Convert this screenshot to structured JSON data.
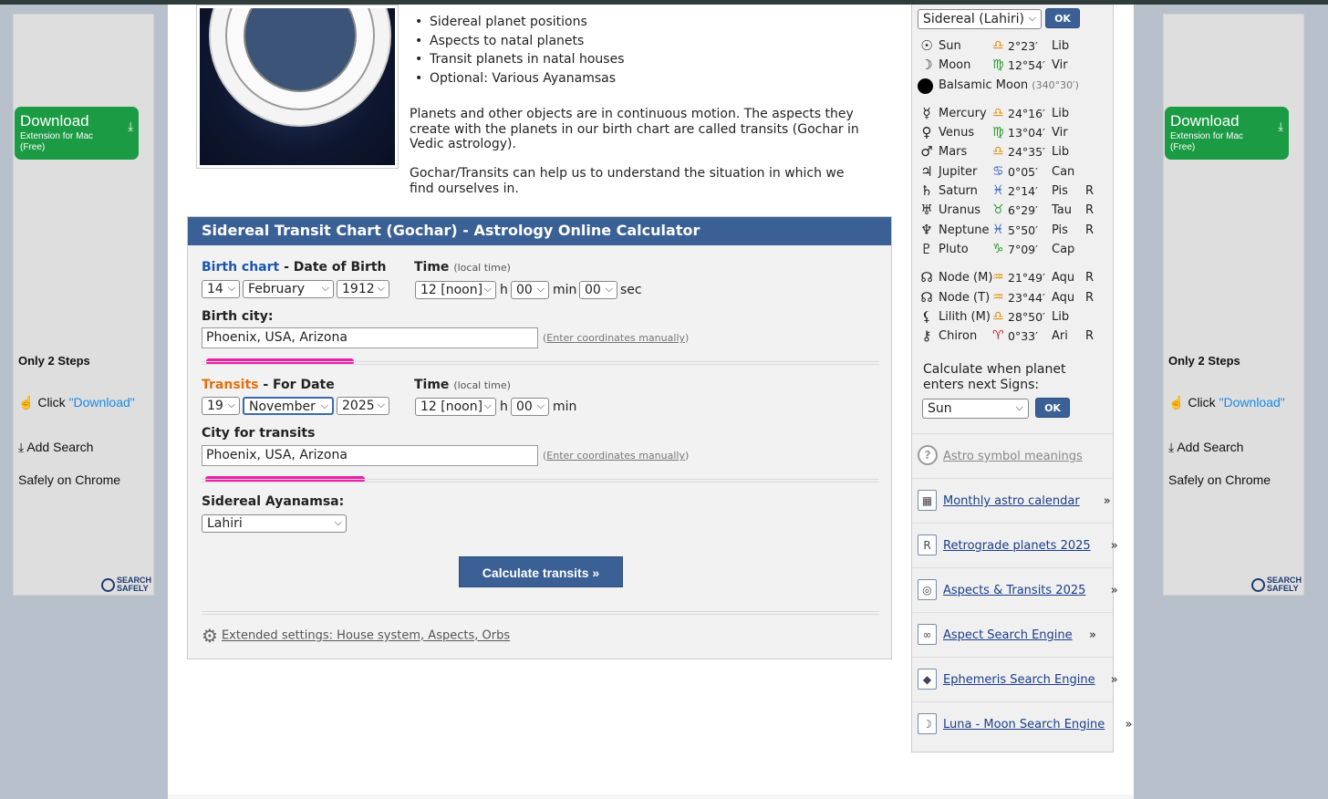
{
  "ad": {
    "download_title": "Download",
    "download_sub": "Extension for Mac (Free)",
    "steps_title": "Only 2 Steps",
    "step1_prefix": "Click ",
    "step1_link": "\"Download\"",
    "step2": "Add Search",
    "step3": "Safely on Chrome",
    "brand_line1": "SEARCH",
    "brand_line2": "SAFELY",
    "colors": {
      "button": "#1b9b43",
      "link": "#1a88e6"
    }
  },
  "intro": {
    "bullets": [
      "Sidereal planet positions",
      "Aspects to natal planets",
      "Transit planets in natal houses",
      "Optional: Various Ayanamsas"
    ],
    "para1": "Planets and other objects are in continuous motion. The aspects they create with the planets in our birth chart are called transits (Gochar in Vedic astrology).",
    "para2": "Gochar/Transits can help us to understand the situation in which we find ourselves in."
  },
  "calc": {
    "title": "Sidereal Transit Chart (Gochar) - Astrology Online Calculator",
    "birth_label_link": "Birth chart",
    "birth_label_rest": " - Date of Birth",
    "time_label": "Time",
    "time_small": "(local time)",
    "birth_day": "14",
    "birth_month": "February",
    "birth_year": "1912",
    "birth_hour": "12 [noon]",
    "birth_min": "00",
    "birth_sec": "00",
    "unit_h": "h",
    "unit_min": "min",
    "unit_sec": "sec",
    "birth_city_label": "Birth city:",
    "birth_city": "Phoenix, USA, Arizona",
    "coords_link": "Enter coordinates manually",
    "transit_label_link": "Transits",
    "transit_label_rest": " - For Date",
    "transit_day": "19",
    "transit_month": "November",
    "transit_year": "2025",
    "transit_hour": "12 [noon]",
    "transit_min": "00",
    "transit_city_label": "City for transits",
    "transit_city": "Phoenix, USA, Arizona",
    "ayanamsa_label": "Sidereal Ayanamsa:",
    "ayanamsa": "Lahiri",
    "calculate_button": "Calculate transits »",
    "extended": "Extended settings: House system, Aspects, Orbs",
    "colors": {
      "header": "#3a6095",
      "birth": "#1a55b0",
      "transit": "#e07010",
      "highlight": "#ee1fa6"
    }
  },
  "sidebar": {
    "ayanamsa_select": "Sidereal (Lahiri)",
    "ok": "OK",
    "planets": [
      {
        "glyph": "☉",
        "name": "Sun",
        "sign_glyph": "♎",
        "deg": "2°23′",
        "sign": "Lib",
        "r": "",
        "el": "air"
      },
      {
        "glyph": "☽",
        "name": "Moon",
        "sign_glyph": "♍",
        "deg": "12°54′",
        "sign": "Vir",
        "r": "",
        "el": "earth"
      }
    ],
    "balsamic": "Balsamic Moon",
    "balsamic_deg": "(340°30′)",
    "planets2": [
      {
        "glyph": "☿",
        "name": "Mercury",
        "sign_glyph": "♎",
        "deg": "24°16′",
        "sign": "Lib",
        "r": "",
        "el": "air"
      },
      {
        "glyph": "♀",
        "name": "Venus",
        "sign_glyph": "♍",
        "deg": "13°04′",
        "sign": "Vir",
        "r": "",
        "el": "earth"
      },
      {
        "glyph": "♂",
        "name": "Mars",
        "sign_glyph": "♎",
        "deg": "24°35′",
        "sign": "Lib",
        "r": "",
        "el": "air"
      },
      {
        "glyph": "♃",
        "name": "Jupiter",
        "sign_glyph": "♋",
        "deg": "0°05′",
        "sign": "Can",
        "r": "",
        "el": "water"
      },
      {
        "glyph": "♄",
        "name": "Saturn",
        "sign_glyph": "♓",
        "deg": "2°14′",
        "sign": "Pis",
        "r": "R",
        "el": "water"
      },
      {
        "glyph": "♅",
        "name": "Uranus",
        "sign_glyph": "♉",
        "deg": "6°29′",
        "sign": "Tau",
        "r": "R",
        "el": "earth"
      },
      {
        "glyph": "♆",
        "name": "Neptune",
        "sign_glyph": "♓",
        "deg": "5°50′",
        "sign": "Pis",
        "r": "R",
        "el": "water"
      },
      {
        "glyph": "♇",
        "name": "Pluto",
        "sign_glyph": "♑",
        "deg": "7°09′",
        "sign": "Cap",
        "r": "",
        "el": "earth"
      }
    ],
    "planets3": [
      {
        "glyph": "☊",
        "name": "Node (M)",
        "sign_glyph": "♒",
        "deg": "21°49′",
        "sign": "Aqu",
        "r": "R",
        "el": "air"
      },
      {
        "glyph": "☊",
        "name": "Node (T)",
        "sign_glyph": "♒",
        "deg": "23°44′",
        "sign": "Aqu",
        "r": "R",
        "el": "air"
      },
      {
        "glyph": "⚸",
        "name": "Lilith (M)",
        "sign_glyph": "♎",
        "deg": "28°50′",
        "sign": "Lib",
        "r": "",
        "el": "air"
      },
      {
        "glyph": "⚷",
        "name": "Chiron",
        "sign_glyph": "♈",
        "deg": "0°33′",
        "sign": "Ari",
        "r": "R",
        "el": "fire"
      }
    ],
    "enter_text": "Calculate when planet enters next Signs:",
    "enter_select": "Sun",
    "links": [
      {
        "icon": "question-icon",
        "text": "Astro symbol meanings",
        "grey": true
      },
      {
        "icon": "calendar-icon",
        "text": "Monthly astro calendar",
        "grey": false
      },
      {
        "icon": "retrograde-icon",
        "text": "Retrograde planets 2025",
        "grey": false
      },
      {
        "icon": "globe-icon",
        "text": "Aspects & Transits 2025",
        "grey": false
      },
      {
        "icon": "aspect-icon",
        "text": "Aspect Search Engine",
        "grey": false
      },
      {
        "icon": "ephemeris-icon",
        "text": "Ephemeris Search Engine",
        "grey": false
      },
      {
        "icon": "moon-icon",
        "text": "Luna - Moon Search Engine",
        "grey": false
      }
    ],
    "raquo": "»"
  }
}
